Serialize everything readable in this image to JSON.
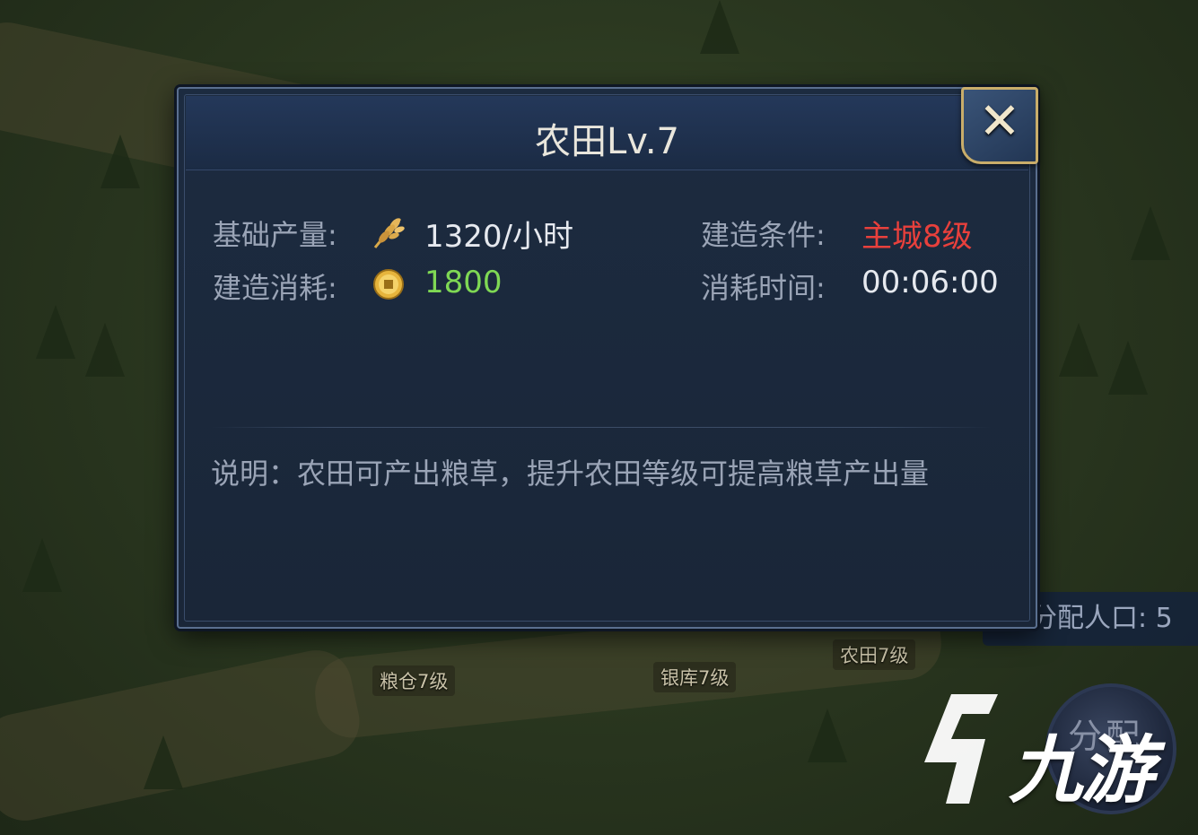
{
  "map": {
    "labels": [
      "粮仓7级",
      "银库7级",
      "农田7级"
    ],
    "population_label": "分配人口: 5",
    "round_button_label": "分配"
  },
  "dialog": {
    "title": "农田Lv.7",
    "close_symbol": "✕",
    "base_output_label": "基础产量:",
    "base_output_icon": "wheat-icon",
    "base_output_value": "1320/小时",
    "build_condition_label": "建造条件:",
    "build_condition_value": "主城8级",
    "build_cost_label": "建造消耗:",
    "build_cost_icon": "coin-icon",
    "build_cost_value": "1800",
    "time_cost_label": "消耗时间:",
    "time_cost_value": "00:06:00",
    "description": "说明：农田可产出粮草，提升农田等级可提高粮草产出量"
  },
  "watermark": {
    "text": "九游"
  },
  "colors": {
    "condition_red": "#e8403c",
    "cost_green": "#7fd854",
    "value_white": "#e6e9ef",
    "label_grey": "#9aa4b6",
    "frame_gold": "#c9ad6a"
  }
}
